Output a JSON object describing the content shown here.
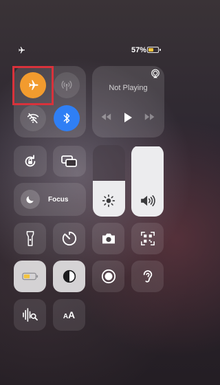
{
  "status_bar": {
    "battery_percent": "57%",
    "battery_level": 0.57,
    "battery_color": "#f3c33c",
    "airplane_mode_icon": "airplane-icon"
  },
  "connectivity": {
    "airplane": {
      "icon": "airplane-icon",
      "active": true,
      "color": "#f29b2e"
    },
    "cellular": {
      "icon": "cellular-antenna-icon",
      "active": false
    },
    "wifi": {
      "icon": "wifi-off-icon",
      "active": false
    },
    "bluetooth": {
      "icon": "bluetooth-icon",
      "active": true,
      "color": "#2f7ff5"
    }
  },
  "highlight_color": "#d9323b",
  "now_playing": {
    "title": "Not Playing",
    "icons": [
      "airplay-icon",
      "rewind-icon",
      "play-icon",
      "fast-forward-icon"
    ]
  },
  "controls": {
    "rotation_lock": {
      "icon": "rotation-lock-icon"
    },
    "screen_mirroring": {
      "icon": "screen-mirroring-icon"
    },
    "focus": {
      "label": "Focus",
      "icon": "moon-icon"
    },
    "brightness": {
      "icon": "sun-icon",
      "level": 0.5
    },
    "volume": {
      "icon": "speaker-icon",
      "level": 0.98
    }
  },
  "grid": [
    "flashlight-icon",
    "timer-icon",
    "camera-icon",
    "qr-scanner-icon",
    "low-power-mode-icon",
    "dark-mode-icon",
    "screen-recording-icon",
    "hearing-icon",
    "sound-recognition-icon",
    "text-size-icon"
  ],
  "text_size": {
    "label_small": "A",
    "label_large": "A"
  }
}
